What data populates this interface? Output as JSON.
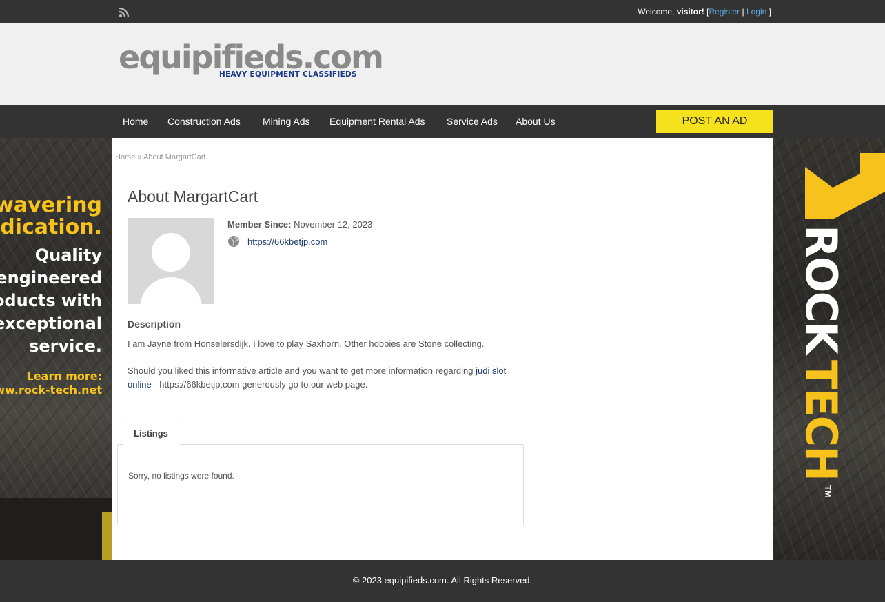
{
  "topbar": {
    "rss_icon": "rss-icon",
    "welcome_prefix": "Welcome,",
    "visitor": "visitor!",
    "bracket_open": "[",
    "register": "Register",
    "separator": "|",
    "login": "Login",
    "bracket_close": "]"
  },
  "header": {
    "logo_main": "equipifieds.com",
    "logo_sub": "HEAVY EQUIPMENT CLASSIFIEDS"
  },
  "nav": {
    "items": [
      "Home",
      "Construction Ads",
      "Mining Ads",
      "Equipment Rental Ads",
      "Service Ads",
      "About Us"
    ],
    "post_ad": "POST AN AD"
  },
  "ad_left": {
    "line1": "nwavering",
    "line2": "edication.",
    "line3": "Quality",
    "line4": "engineered",
    "line5": "oducts with",
    "line6": "exceptional",
    "line7": "service.",
    "line8": "Learn more:",
    "line9": "ww.rock-tech.net"
  },
  "ad_right": {
    "brand_rock": "ROCK",
    "brand_tech": "TECH",
    "tm": "TM"
  },
  "breadcrumb": {
    "home": "Home",
    "sep": "»",
    "current": "About MargartCart"
  },
  "profile": {
    "title": "About MargartCart",
    "member_since_label": "Member Since:",
    "member_since_value": "November 12, 2023",
    "website": "https://66kbetjp.com",
    "description_heading": "Description",
    "description_line1": "I am Jayne from Honselersdijk. I love to play Saxhorn. Other hobbies are Stone collecting.",
    "description_p2_before": "Should you liked this informative article and you want to get more information regarding ",
    "description_p2_link": "judi slot online",
    "description_p2_after": " - https://66kbetjp.com generously go to our web page."
  },
  "listings": {
    "tab_label": "Listings",
    "empty_message": "Sorry, no listings were found."
  },
  "footer": {
    "copyright": "© 2023 equipifieds.com. All Rights Reserved."
  },
  "colors": {
    "dark_bar": "#333333",
    "post_button": "#f5e11c",
    "link_blue": "#5aa7e0",
    "logo_navy": "#1b3a8c",
    "ad_yellow": "#f7c21b"
  }
}
